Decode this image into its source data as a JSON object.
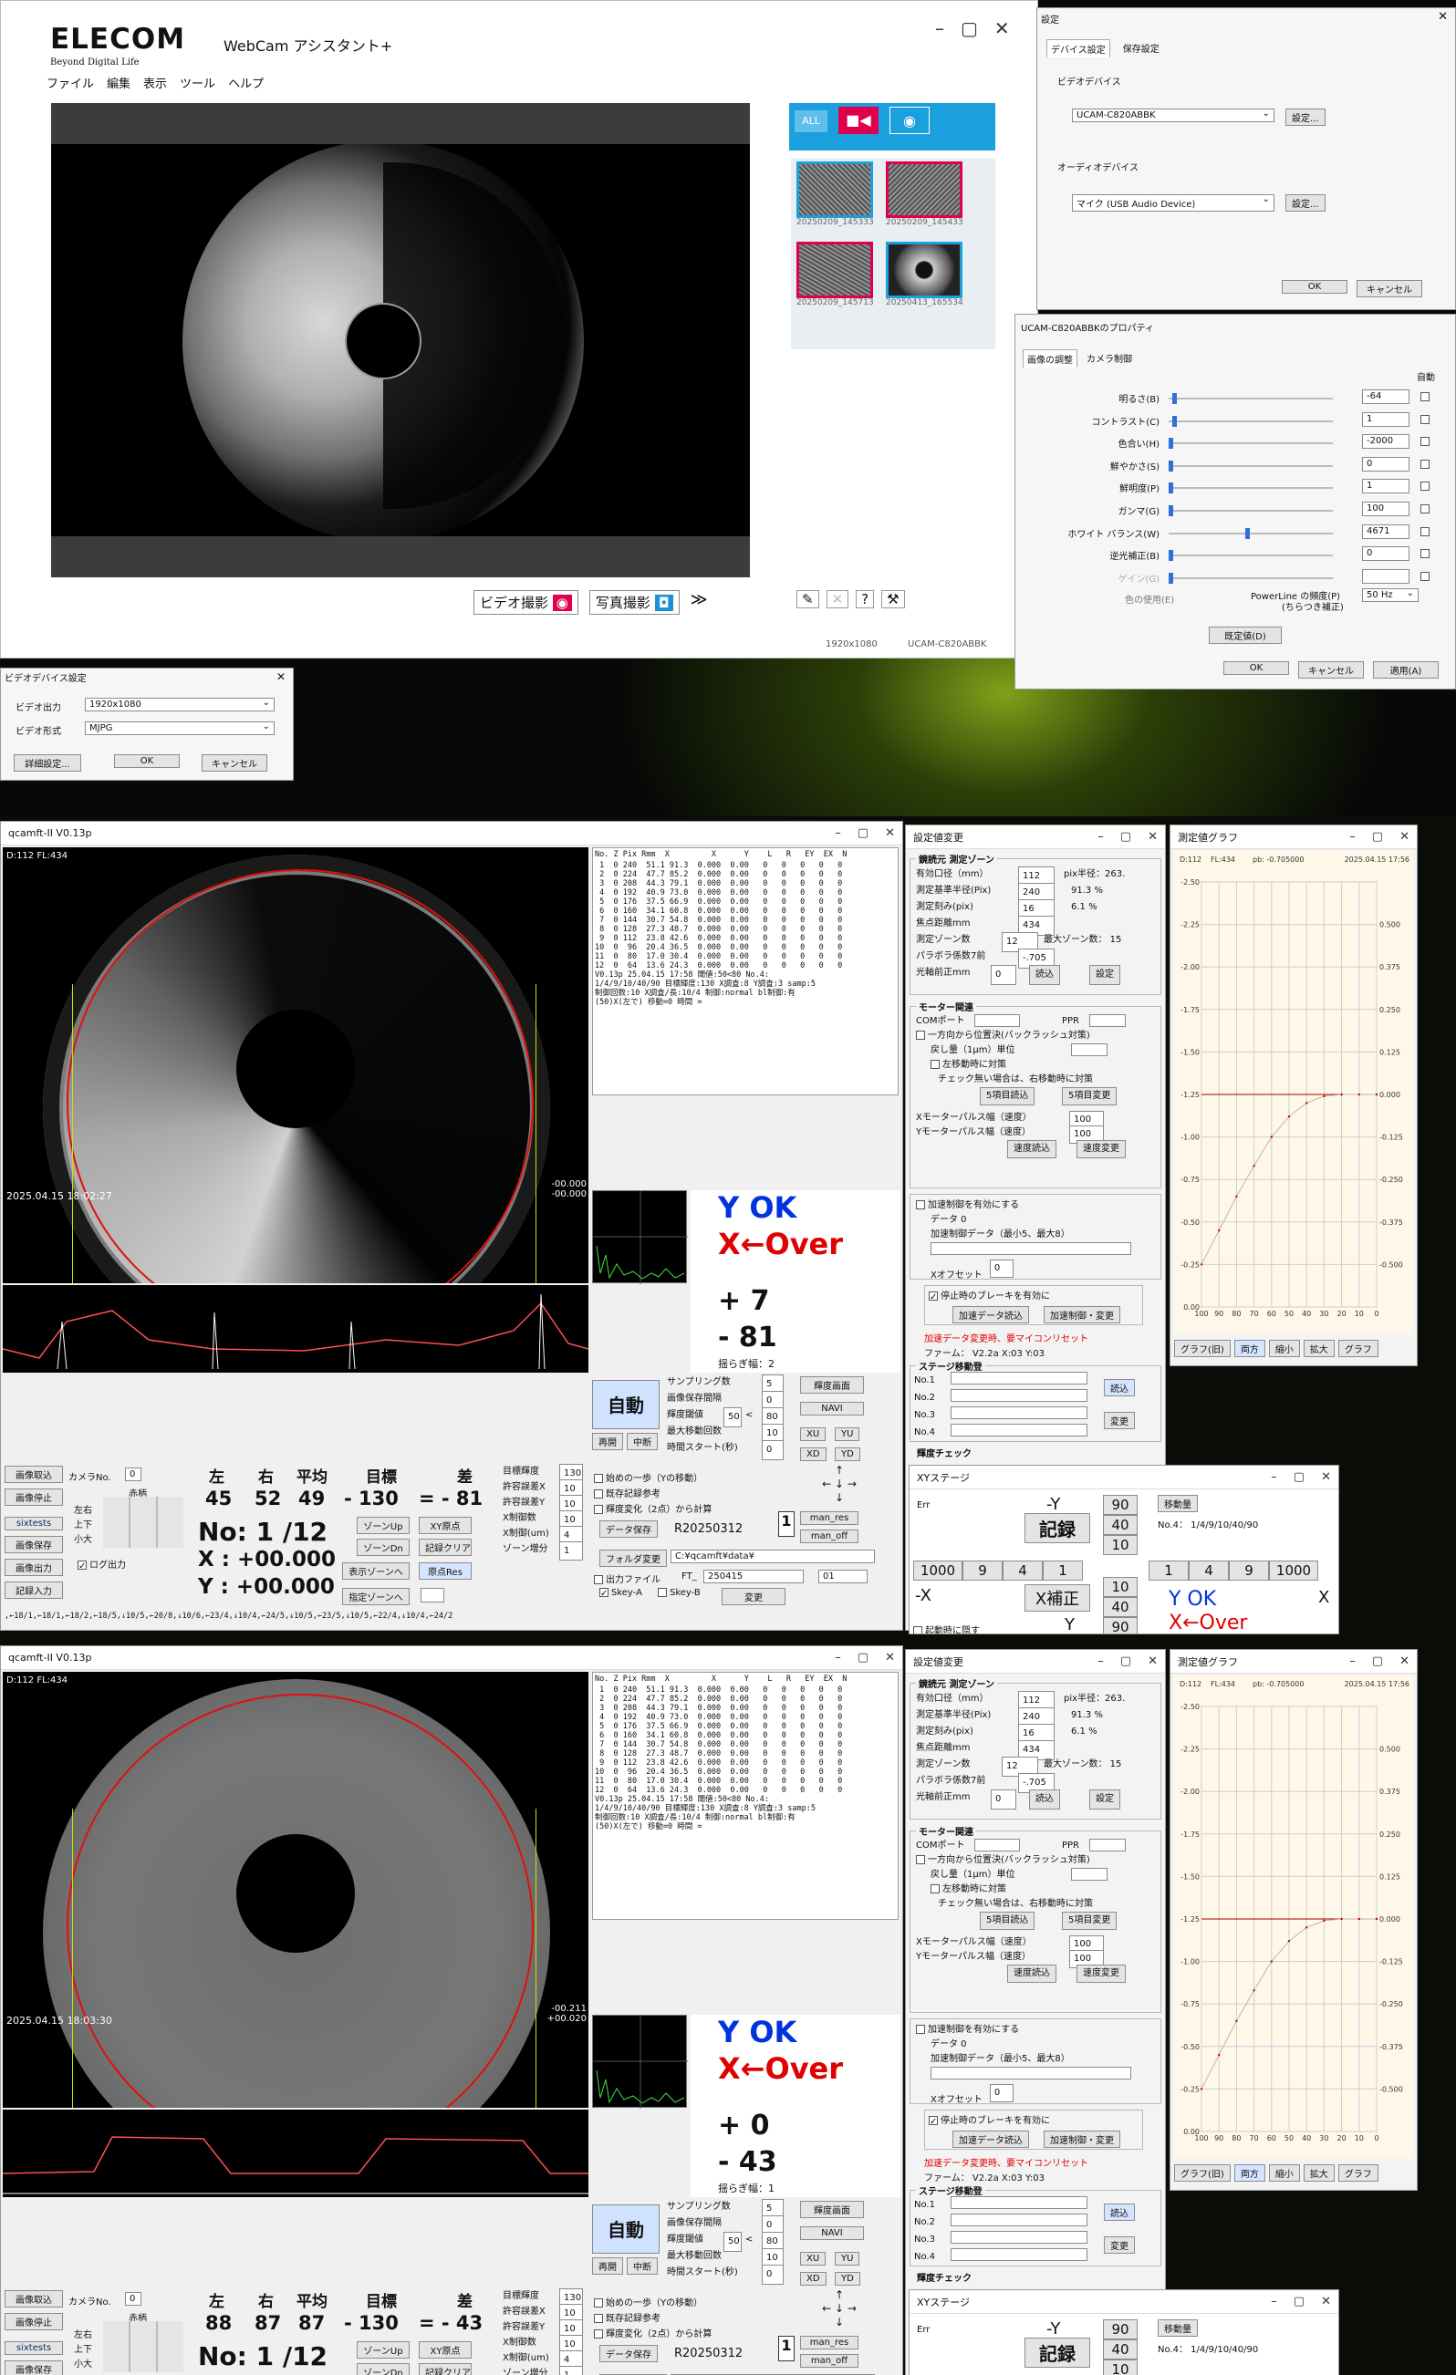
{
  "webcam": {
    "brand": "ELECOM",
    "tagline": "Beyond Digital Life",
    "title": "WebCam アシスタント+",
    "menu": [
      "ファイル",
      "編集",
      "表示",
      "ツール",
      "ヘルプ"
    ],
    "tabs": [
      "ALL",
      "video",
      "photo"
    ],
    "thumbs": [
      "20250209_145333",
      "20250209_145433",
      "20250209_145713",
      "20250413_165534"
    ],
    "video_button": "ビデオ撮影",
    "photo_button": "写真撮影",
    "resolution": "1920x1080",
    "device": "UCAM-C820ABBK"
  },
  "settings": {
    "title": "設定",
    "tabs": [
      "デバイス設定",
      "保存設定"
    ],
    "video_label": "ビデオデバイス",
    "video_device": "UCAM-C820ABBK",
    "audio_label": "オーディオデバイス",
    "audio_device": "マイク (USB Audio Device)",
    "setup": "設定...",
    "ok": "OK",
    "cancel": "キャンセル"
  },
  "props": {
    "title": "UCAM-C820ABBKのプロパティ",
    "tabs": [
      "画像の調整",
      "カメラ制御"
    ],
    "auto": "自動",
    "rows": [
      {
        "label": "明るさ(B)",
        "value": "-64",
        "pos": 0.02
      },
      {
        "label": "コントラスト(C)",
        "value": "1",
        "pos": 0.02
      },
      {
        "label": "色合い(H)",
        "value": "-2000",
        "pos": 0.0
      },
      {
        "label": "鮮やかさ(S)",
        "value": "0",
        "pos": 0.0
      },
      {
        "label": "鮮明度(P)",
        "value": "1",
        "pos": 0.0
      },
      {
        "label": "ガンマ(G)",
        "value": "100",
        "pos": 0.0
      },
      {
        "label": "ホワイト バランス(W)",
        "value": "4671",
        "pos": 0.48
      },
      {
        "label": "逆光補正(B)",
        "value": "0",
        "pos": 0.0
      },
      {
        "label": "ゲイン(G)",
        "value": "",
        "pos": 0.0
      }
    ],
    "color_label": "色の使用(E)",
    "powerline_label": "PowerLine の頻度(P)",
    "powerline_sub": "(ちらつき補正)",
    "powerline_value": "50 Hz",
    "default": "既定値(D)",
    "ok": "OK",
    "cancel": "キャンセル",
    "apply": "適用(A)"
  },
  "vdev": {
    "title": "ビデオデバイス設定",
    "out_label": "ビデオ出力",
    "out_value": "1920x1080",
    "fmt_label": "ビデオ形式",
    "fmt_value": "MJPG",
    "detail": "詳細設定...",
    "ok": "OK",
    "cancel": "キャンセル"
  },
  "q1": {
    "title": "qcamft-II  V0.13p",
    "info": "D:112 FL:434",
    "timestamp": "2025.04.15 18:02:27",
    "side_vals": "-00.000\n-00.000",
    "yok": "Y OK",
    "xover": "X←Over",
    "plus": "+ 7",
    "minus": "- 81",
    "yurag": "揺らぎ幅：2",
    "hdr": [
      "左",
      "右",
      "平均",
      "目標",
      "差"
    ],
    "vals": [
      "45",
      "52",
      "49",
      "- 130",
      "= - 81"
    ],
    "no": "No: 1 /12",
    "x": "X : +00.000",
    "y": "Y : +00.000",
    "bottom": ",←18/1,←18/1,←18/2,←18/5,↓10/5,←20/8,↓10/6,←23/4,↓10/4,←24/5,↓10/5,←23/5,↓10/5,←22/4,↓10/4,←24/2"
  },
  "q2": {
    "title": "qcamft-II  V0.13p",
    "info": "D:112 FL:434",
    "timestamp": "2025.04.15 18:03:30",
    "side_vals": "-00.211\n+00.020",
    "yok": "Y OK",
    "xover": "X←Over",
    "plus": "+ 0",
    "minus": "- 43",
    "yurag": "揺らぎ幅：1",
    "hdr": [
      "左",
      "右",
      "平均",
      "目標",
      "差"
    ],
    "vals": [
      "88",
      "87",
      "87",
      "- 130",
      "= - 43"
    ],
    "no": "No: 1 /12",
    "x": "",
    "y": "",
    "bottom": ""
  },
  "table": {
    "header": "No. Z Pix Rmm  X         X      Y    L   R   EY  EX  N",
    "rows": [
      " 1  0 240  51.1 91.3  0.000  0.00   0   0   0   0   0",
      " 2  0 224  47.7 85.2  0.000  0.00   0   0   0   0   0",
      " 3  0 208  44.3 79.1  0.000  0.00   0   0   0   0   0",
      " 4  0 192  40.9 73.0  0.000  0.00   0   0   0   0   0",
      " 5  0 176  37.5 66.9  0.000  0.00   0   0   0   0   0",
      " 6  0 160  34.1 60.8  0.000  0.00   0   0   0   0   0",
      " 7  0 144  30.7 54.8  0.000  0.00   0   0   0   0   0",
      " 8  0 128  27.3 48.7  0.000  0.00   0   0   0   0   0",
      " 9  0 112  23.8 42.6  0.000  0.00   0   0   0   0   0",
      "10  0  96  20.4 36.5  0.000  0.00   0   0   0   0   0",
      "11  0  80  17.0 30.4  0.000  0.00   0   0   0   0   0",
      "12  0  64  13.6 24.3  0.000  0.00   0   0   0   0   0"
    ],
    "notes": [
      "V0.13p 25.04.15 17:58 閾値:50<80 No.4:",
      "1/4/9/10/40/90 目標輝度:130 X調査:8 Y調査:3 samp:5",
      "制御回数:10 X調査/長:10/4 制御:normal bl制御:有",
      "(50)X(左で) 移動=0 時間 ="
    ]
  },
  "ctrl": {
    "auto": "自動",
    "restart": "再開",
    "pause": "中断",
    "sampling": "サンプリング数",
    "sampling_v": "5",
    "interval": "画像保存間隔",
    "interval_v": "0",
    "thresh": "輝度閾値",
    "thresh_a": "50",
    "thresh_b": "80",
    "maxmove": "最大移動回数",
    "maxmove_v": "10",
    "timer": "時間スタート(秒)",
    "timer_v": "0",
    "brightness_btn": "輝度画面",
    "navi": "NAVI",
    "xu": "XU",
    "yu": "YU",
    "xd": "XD",
    "yd": "YD",
    "capture": "画像取込",
    "stop": "画像停止",
    "save": "画像保存",
    "out": "画像出力",
    "rec_in": "記録入力",
    "sixteen": "sixtests",
    "camera_no": "カメラNo.",
    "camera_v": "0",
    "red_frame": "赤柄",
    "lr": "左右",
    "ud": "上下",
    "lg": "小大",
    "log": "ログ出力",
    "zone_up": "ゾーンUp",
    "zone_dn": "ゾーンDn",
    "show_zone": "表示ゾーンへ",
    "spec_zone": "指定ゾーンへ",
    "xy_origin": "XY原点",
    "rec_clear": "記録クリア",
    "origin_res": "原点Res",
    "target_b": "目標輝度",
    "target_bv": "130",
    "tol_x": "許容誤差X",
    "tol_xv": "10",
    "tol_y": "許容誤差Y",
    "tol_yv": "10",
    "xctrl": "X制御数",
    "xctrl_v": "10",
    "xum": "X制御(um)",
    "xum_v": "4",
    "zone_inc": "ゾーン増分",
    "zone_inc_v": "1",
    "first_step": "始めの一歩（Yの移動）",
    "keep_ref": "既存記録参考",
    "bright_change": "輝度変化（2点）から計算",
    "data_save": "データ保存",
    "data_id": "R20250312",
    "one": "1",
    "man_res": "man_res",
    "man_off": "man_off",
    "folder": "フォルダ変更",
    "folder_v": "C:¥qcamft¥data¥",
    "outfile": "出力ファイル",
    "ft": "FT_",
    "ft_v": "250415",
    "ft_b": "01",
    "skey_a": "Skey-A",
    "skey_b": "Skey-B",
    "change": "変更"
  },
  "sv": {
    "title": "設定値変更",
    "zone_group": "鏡読元 測定ゾーン",
    "aperture": "有効口径（mm）",
    "aperture_v": "112",
    "pix_label": "pix半径：263.",
    "ref_r": "測定基準半径(Pix)",
    "ref_rv": "240",
    "pct1": "91.3 %",
    "step": "測定刻み(pix)",
    "step_v": "16",
    "pct2": "6.1 %",
    "focal": "焦点距離mm",
    "focal_v": "434",
    "zones": "測定ゾーン数",
    "zones_v": "12",
    "maxzone": "最大ゾーン数： 15",
    "parab": "パラボラ係数7前",
    "parab_v": "-.705",
    "axis": "光軸前正mm",
    "axis_v": "0",
    "read": "読込",
    "set": "設定",
    "motor_group": "モーター関連",
    "com": "COMポート",
    "ppr": "PPR",
    "oneway": "一方向から位置決(バックラッシュ対策)",
    "back": "戻し量（1μm）単位",
    "left_move": "左移動時に対策",
    "check_note": "チェック無い場合は、右移動時に対策",
    "item5_read": "5項目読込",
    "item5_change": "5項目変更",
    "xpulse": "Xモーターパルス幅（速度）",
    "xpulse_v": "100",
    "ypulse": "Yモーターパルス幅（速度）",
    "ypulse_v": "100",
    "speed_read": "速度読込",
    "speed_change": "速度変更",
    "accel": "加速制御を有効にする",
    "data0": "データ 0",
    "accel_data": "加速制御データ（最小5、最大8）",
    "xoffset": "Xオフセット",
    "xoffset_v": "0",
    "brake": "停止時のブレーキを有効に",
    "accel_read": "加速データ読込",
    "accel_change": "加速制御・変更",
    "warn": "加速データ変更時、要マイコンリセット",
    "firm": "ファーム： V2.2a   X:03  Y:03",
    "stage_group": "ステージ移動登",
    "stage_nos": [
      "No.1",
      "No.2",
      "No.3",
      "No.4"
    ],
    "stage_read": "読込",
    "stage_change": "変更",
    "brightness_check": "輝度チェック"
  },
  "graph": {
    "title": "測定値グラフ",
    "info1": "D:112",
    "info2": "FL:434",
    "info3": "pb: -0.705000",
    "date": "2025.04.15 17:56",
    "buttons": [
      "グラフ(旧)",
      "両方",
      "縮小",
      "拡大",
      "グラフ"
    ]
  },
  "chart_data": {
    "type": "line",
    "title": "",
    "xlabel": "",
    "ylabel": "",
    "x": [
      100,
      90,
      80,
      70,
      60,
      50,
      40,
      30,
      20,
      10,
      0
    ],
    "y_left_ticks": [
      "-2.50",
      "-2.25",
      "-2.00",
      "-1.75",
      "-1.50",
      "-1.25",
      "-1.00",
      "-0.75",
      "-0.50",
      "-0.25",
      "0.00"
    ],
    "y_right_ticks": [
      "0.500",
      "0.375",
      "0.250",
      "0.125",
      "0.000",
      "-0.125",
      "-0.250",
      "-0.375",
      "-0.500"
    ],
    "grid": true,
    "series": [
      {
        "values": [
          -0.25,
          -0.45,
          -0.65,
          -0.83,
          -1.0,
          -1.12,
          -1.2,
          -1.24,
          -1.25,
          -1.25,
          -1.25
        ]
      }
    ]
  },
  "xy": {
    "title": "XYステージ",
    "err": "Err",
    "neg_y": "-Y",
    "v90": "90",
    "v40": "40",
    "v10": "10",
    "move": "移動量",
    "move_v": "No.4： 1/4/9/10/40/90",
    "record": "記録",
    "neg_x": "-X",
    "xcorr": "X補正",
    "x_label": "X",
    "y_label": "Y",
    "row": [
      "1000",
      "9",
      "4",
      "1",
      "",
      "1",
      "4",
      "9",
      "1000"
    ],
    "yok": "Y OK",
    "xover": "X←Over",
    "hide": "起動時に隠す"
  }
}
